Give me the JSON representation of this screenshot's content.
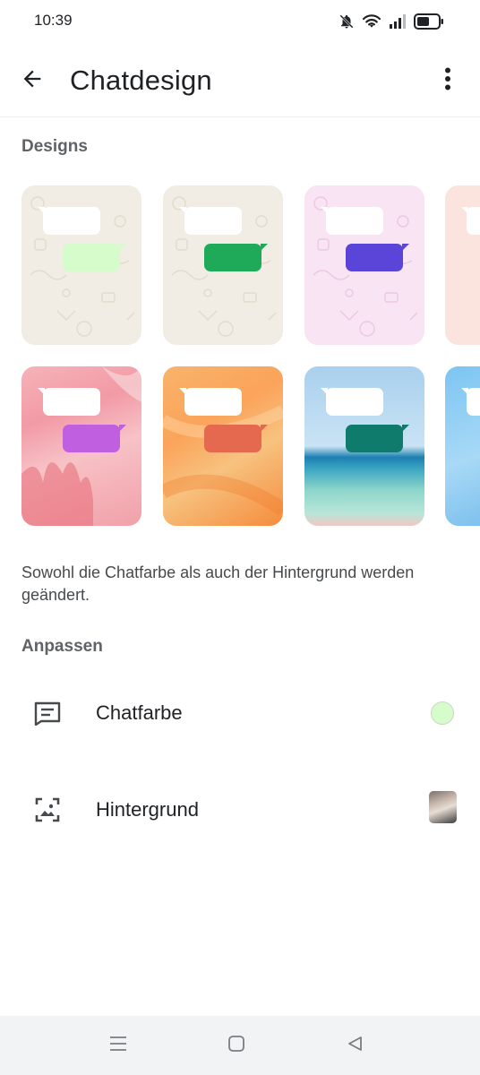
{
  "status_bar": {
    "time": "10:39",
    "icons": [
      "bell-off-icon",
      "wifi-icon",
      "signal-icon",
      "battery-icon"
    ]
  },
  "app_bar": {
    "title": "Chatdesign",
    "back_icon": "arrow-left-icon",
    "menu_icon": "more-vert-icon"
  },
  "designs": {
    "heading": "Designs",
    "items": [
      {
        "name": "design-doodle-beige-light-green",
        "background": "doodle-beige",
        "bubble_color": "#d6fccb"
      },
      {
        "name": "design-doodle-beige-green",
        "background": "doodle-beige",
        "bubble_color": "#1faa59"
      },
      {
        "name": "design-doodle-pink-purple",
        "background": "doodle-pink",
        "bubble_color": "#5a45d8"
      },
      {
        "name": "design-partial-1",
        "background": "doodle-peach",
        "bubble_color": "#f28b82"
      },
      {
        "name": "design-pink-floral-magenta",
        "background": "pink-photo",
        "bubble_color": "#c05fe0"
      },
      {
        "name": "design-orange-coral",
        "background": "orange-photo",
        "bubble_color": "#e4694f"
      },
      {
        "name": "design-beach-teal",
        "background": "beach-photo",
        "bubble_color": "#0e7b6c"
      },
      {
        "name": "design-partial-2",
        "background": "blue-photo",
        "bubble_color": "#2f8fd8"
      }
    ]
  },
  "caption": "Sowohl die Chatfarbe als auch der Hintergrund werden geändert.",
  "customize": {
    "heading": "Anpassen",
    "chat_color": {
      "label": "Chatfarbe",
      "icon": "chat-bubble-icon",
      "value_color": "#d6fccb"
    },
    "background": {
      "label": "Hintergrund",
      "icon": "wallpaper-icon"
    }
  },
  "nav_bar": {
    "icons": [
      "menu-icon",
      "home-icon",
      "back-triangle-icon"
    ]
  },
  "colors": {
    "text_primary": "#1f2124",
    "text_secondary": "#5f6368",
    "divider": "#eceeef",
    "nav_background": "#f2f3f4"
  }
}
